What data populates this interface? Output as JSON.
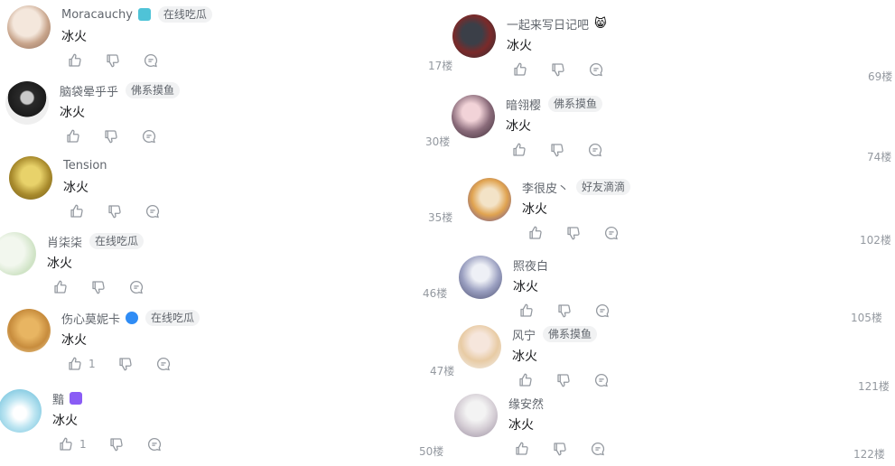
{
  "left": [
    {
      "name": "Moracauchy",
      "badge": "lightblue",
      "tag": "在线吃瓜",
      "content": "冰火",
      "likes": "",
      "floor": "17楼"
    },
    {
      "name": "脑袋晕乎乎",
      "badge": "",
      "tag": "佛系摸鱼",
      "content": "冰火",
      "likes": "",
      "floor": "30楼"
    },
    {
      "name": "Tension",
      "badge": "",
      "tag": "",
      "content": "冰火",
      "likes": "",
      "floor": "35楼"
    },
    {
      "name": "肖柒柒",
      "badge": "",
      "tag": "在线吃瓜",
      "content": "冰火",
      "likes": "",
      "floor": "46楼"
    },
    {
      "name": "伤心莫妮卡",
      "badge": "blue",
      "tag": "在线吃瓜",
      "content": "冰火",
      "likes": "1",
      "floor": "47楼"
    },
    {
      "name": "黯",
      "badge": "purple",
      "tag": "",
      "content": "冰火",
      "likes": "1",
      "floor": "50楼"
    }
  ],
  "right": [
    {
      "name": "一起来写日记吧",
      "badge": "",
      "tag": "",
      "emoji": "😸",
      "content": "冰火",
      "likes": "",
      "floor": "69楼"
    },
    {
      "name": "暗翎樱",
      "badge": "",
      "tag": "佛系摸鱼",
      "content": "冰火",
      "likes": "",
      "floor": "74楼"
    },
    {
      "name": "李很皮丶",
      "badge": "",
      "tag": "好友滴滴",
      "content": "冰火",
      "likes": "",
      "floor": "102楼"
    },
    {
      "name": "照夜白",
      "badge": "",
      "tag": "",
      "content": "冰火",
      "likes": "",
      "floor": "105楼"
    },
    {
      "name": "风宁",
      "badge": "",
      "tag": "佛系摸鱼",
      "content": "冰火",
      "likes": "",
      "floor": "121楼"
    },
    {
      "name": "缘安然",
      "badge": "",
      "tag": "",
      "content": "冰火",
      "likes": "",
      "floor": "122楼"
    }
  ],
  "colors": {
    "username": "#61666d",
    "content": "#18191c",
    "meta": "#9499a0",
    "tag_bg": "#f1f2f3",
    "badge_lightblue": "#4fc3d7",
    "badge_blue": "#2f8cf5",
    "badge_purple": "#8a5cf5"
  },
  "icons": {
    "like": "thumb-up-icon",
    "dislike": "thumb-down-icon",
    "reply": "reply-bubble-icon"
  }
}
